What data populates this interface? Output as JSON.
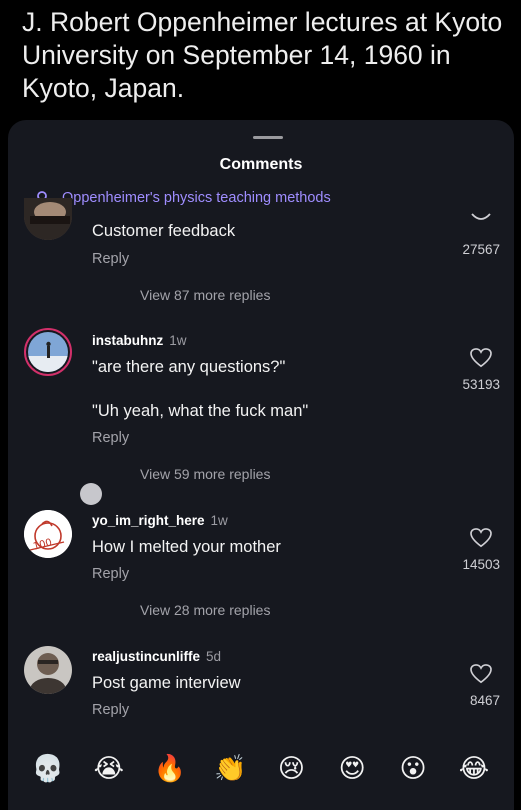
{
  "caption": "J. Robert Oppenheimer lectures at Kyoto University on September 14, 1960 in Kyoto, Japan.",
  "sheet": {
    "title": "Comments",
    "search_suggestion": "Oppenheimer's physics teaching methods",
    "search_icon": "search-icon"
  },
  "comments": [
    {
      "text": "Customer feedback",
      "reply_label": "Reply",
      "likes": "27567",
      "view_replies": "View 87 more replies"
    },
    {
      "username": "instabuhnz",
      "time": "1w",
      "text": "\"are there any questions?\"",
      "text2": "\"Uh yeah, what the fuck man\"",
      "reply_label": "Reply",
      "likes": "53193",
      "view_replies": "View 59 more replies"
    },
    {
      "username": "yo_im_right_here",
      "time": "1w",
      "text": "How I melted your mother",
      "reply_label": "Reply",
      "likes": "14503",
      "view_replies": "View 28 more replies"
    },
    {
      "username": "realjustincunliffe",
      "time": "5d",
      "text": "Post game interview",
      "reply_label": "Reply",
      "likes": "8467"
    }
  ],
  "avatar_badge_text": "100",
  "emoji_bar": [
    "💀",
    "😭",
    "🔥",
    "👏",
    "😢",
    "😍",
    "😮",
    "😂"
  ],
  "colors": {
    "background": "#000000",
    "sheet": "#16181f",
    "accent_search": "#9f8dff",
    "muted_text": "#a3a3aa"
  }
}
